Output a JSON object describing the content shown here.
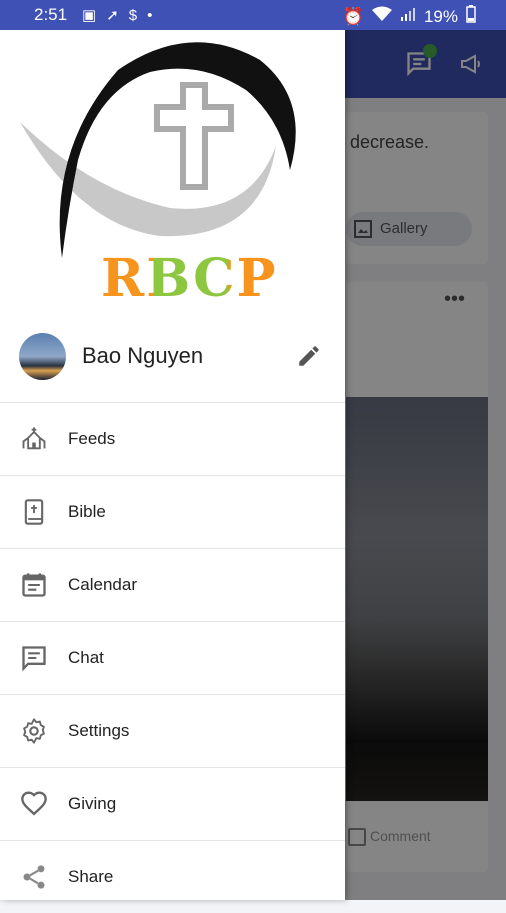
{
  "status_bar": {
    "time": "2:51",
    "battery": "19%"
  },
  "background": {
    "post_snippet": "decrease.",
    "gallery_label": "Gallery",
    "comment_label": "Comment",
    "notification_badge": ""
  },
  "app": {
    "logo_text": "RBCP"
  },
  "profile": {
    "name": "Bao Nguyen"
  },
  "menu": [
    {
      "label": "Feeds",
      "icon": "church-icon"
    },
    {
      "label": "Bible",
      "icon": "bible-icon"
    },
    {
      "label": "Calendar",
      "icon": "calendar-icon"
    },
    {
      "label": "Chat",
      "icon": "chat-icon"
    },
    {
      "label": "Settings",
      "icon": "settings-icon"
    },
    {
      "label": "Giving",
      "icon": "heart-icon"
    },
    {
      "label": "Share",
      "icon": "share-icon"
    }
  ],
  "colors": {
    "primary": "#3f51b5",
    "logo_orange": "#f7941d",
    "logo_green": "#8dc63f"
  }
}
